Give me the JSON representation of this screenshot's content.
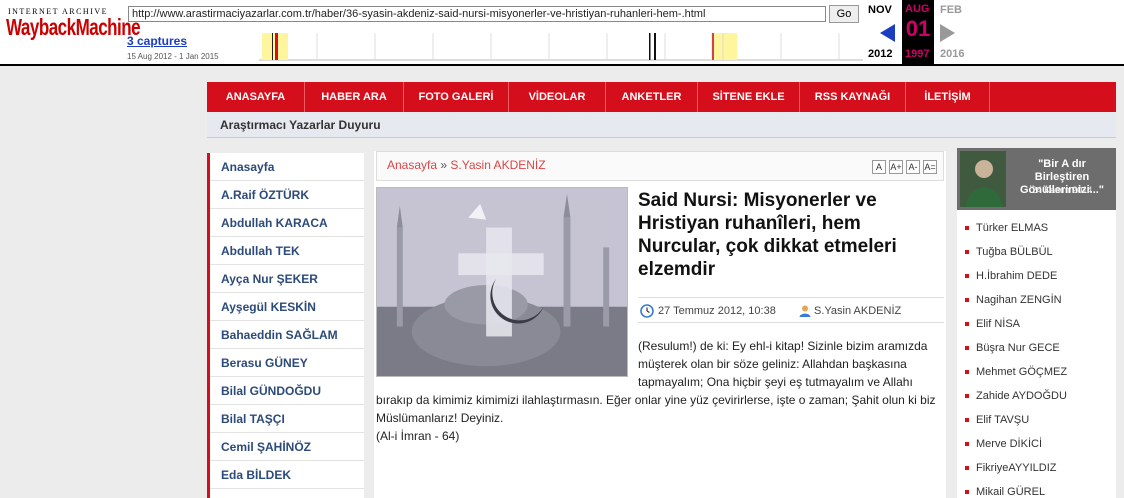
{
  "wayback": {
    "logo_top": "INTERNET ARCHIVE",
    "logo_main": "WaybackMachine",
    "url": "http://www.arastirmaciyazarlar.com.tr/haber/36-syasin-akdeniz-said-nursi-misyonerler-ve-hristiyan-ruhanleri-hem-.html",
    "go_label": "Go",
    "captures": "3 captures",
    "range": "15 Aug 2012 - 1 Jan 2015",
    "months": {
      "prev": "NOV",
      "cur": "AUG",
      "next": "FEB"
    },
    "day": "01",
    "years": {
      "prev": "2012",
      "cur": "1997",
      "next": "2016"
    },
    "colors": {
      "accent": "#cc0066",
      "arrow": "#1a3dc1"
    }
  },
  "site": {
    "nav": [
      "ANASAYFA",
      "HABER ARA",
      "FOTO GALERİ",
      "VİDEOLAR",
      "ANKETLER",
      "SİTENE EKLE",
      "RSS KAYNAĞI",
      "İLETİŞİM"
    ],
    "subnav": "Araştırmacı Yazarlar Duyuru",
    "left_menu": [
      "Anasayfa",
      "A.Raif ÖZTÜRK",
      "Abdullah KARACA",
      "Abdullah TEK",
      "Ayça Nur ŞEKER",
      "Ayşegül KESKİN",
      "Bahaeddin SAĞLAM",
      "Berasu GÜNEY",
      "Bilal GÜNDOĞDU",
      "Bilal TAŞÇI",
      "Cemil ŞAHİNÖZ",
      "Eda BİLDEK"
    ],
    "breadcrumb": {
      "home": "Anasayfa",
      "sep": "»",
      "current": "S.Yasin AKDENİZ"
    },
    "font_buttons": [
      "A",
      "A+",
      "A-",
      "A="
    ],
    "headline": "Said Nursi: Misyonerler ve Hristiyan ruhanîleri, hem Nurcular, çok dikkat etmeleri elzemdir",
    "date": "27 Temmuz 2012, 10:38",
    "author": "S.Yasin AKDENİZ",
    "body_p1": "(Resulum!) de ki: Ey ehl-i kitap! Sizinle bizim aramızda müşterek olan bir söze geliniz: Allahdan başkasına tapmayalım; Ona hiçbir şeyi eş tutmayalım ve Allahı",
    "body_p2": "bırakıp da kimimiz kimimizi ilahlaştırmasın. Eğer onlar yine yüz çevirirlerse, işte o zaman; Şahit olun ki biz Müslümanlarız! Deyiniz.",
    "body_p3": "(Al-i İmran - 64)",
    "feature_quote": "\"Bir A dır Birleştiren Gönüllerimizi...\"",
    "feature_date": "24 Kasım 2014",
    "right_authors": [
      "Türker ELMAS",
      "Tuğba BÜLBÜL",
      "H.İbrahim DEDE",
      "Nagihan ZENGİN",
      "Elif NİSA",
      "Büşra Nur GECE",
      "Mehmet GÖÇMEZ",
      "Zahide AYDOĞDU",
      "Elif TAVŞU",
      "Merve DİKİCİ",
      "FikriyeAYYILDIZ",
      "Mikail GÜREL"
    ],
    "colors": {
      "brand": "#d40e1a",
      "link": "#2c4a7a"
    }
  }
}
